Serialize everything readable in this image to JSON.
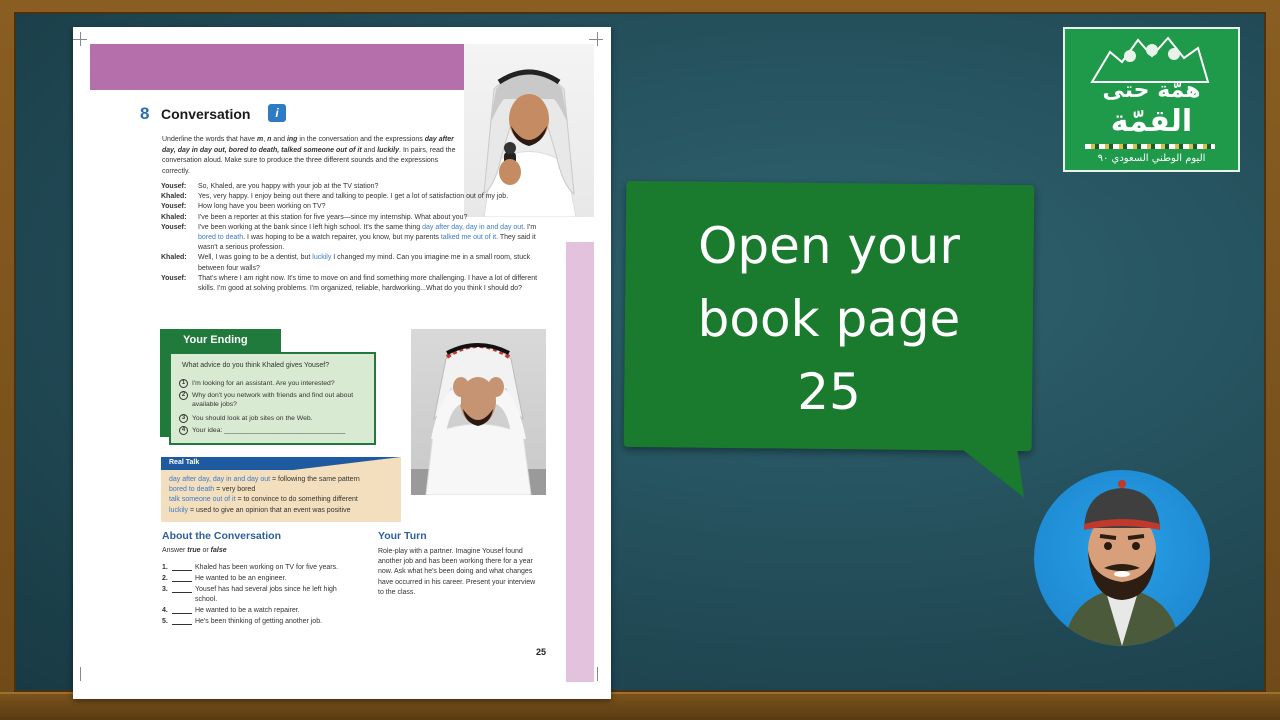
{
  "book": {
    "section_number": "8",
    "section_title": "Conversation",
    "info_icon": "info-icon",
    "intro": {
      "line1": "Underline the words that have ",
      "m": "m",
      "sep1": ", ",
      "n": "n",
      "and1": " and ",
      "ing": "ing",
      "line1b": " in the conversation and the expressions",
      "kw1": "day after day, day in day out, bored to death, talked someone out of it",
      "and2": " and ",
      "kw2": "luckily",
      "dot": ".",
      "line3": "In pairs, read the conversation aloud. Make sure to produce the three different sounds and the expressions correctly."
    },
    "dialogue": [
      {
        "speaker": "Yousef:",
        "text": "So, Khaled, are you happy with your job at the TV station?"
      },
      {
        "speaker": "Khaled:",
        "text": "Yes, very happy. I enjoy being out there and talking to people. I get a lot of satisfaction out of my job."
      },
      {
        "speaker": "Yousef:",
        "text": "How long have you been working on TV?"
      },
      {
        "speaker": "Khaled:",
        "text": "I've been a reporter at this station for five years—since my internship. What about you?"
      },
      {
        "speaker": "Yousef:",
        "text_a": "I've been working at the bank since I left high school. It's the same thing ",
        "hl1": "day after day, day in and day out",
        "text_b": ". I'm ",
        "hl2": "bored to death",
        "text_c": ". I was hoping to be a watch repairer, you know, but my parents ",
        "hl3": "talked me out of it",
        "text_d": ". They said it wasn't a serious profession."
      },
      {
        "speaker": "Khaled:",
        "text_a": "Well, I was going to be a dentist, but ",
        "hl1": "luckily",
        "text_b": " I changed my mind. Can you imagine me in a small room, stuck between four walls?"
      },
      {
        "speaker": "Yousef:",
        "text": "That's where I am right now. It's time to move on and find something more challenging. I have a lot of different skills. I'm good at solving problems. I'm organized, reliable, hardworking...What do you think I should do?"
      }
    ],
    "your_ending": {
      "title": "Your Ending",
      "question": "What advice do you think Khaled gives Yousef?",
      "options": [
        {
          "n": "1",
          "text": "I'm looking for an assistant. Are you interested?"
        },
        {
          "n": "2",
          "text": "Why don't you network with friends and find out about available jobs?"
        },
        {
          "n": "3",
          "text": "You should look at job sites on the Web."
        },
        {
          "n": "4",
          "text": "Your idea: ________________________________"
        }
      ]
    },
    "real_talk": {
      "title": "Real Talk",
      "items": [
        {
          "term": "day after day, day in and day out",
          "def": " = following the same pattern"
        },
        {
          "term": "bored to death",
          "def": " = very bored"
        },
        {
          "term": "talk someone out of it",
          "def": " = to convince to do something different"
        },
        {
          "term": "luckily",
          "def": " = used to give an opinion that an event was positive"
        }
      ]
    },
    "about": {
      "title": "About the Conversation",
      "sub_a": "Answer ",
      "true": "true",
      "or": " or ",
      "false": "false",
      "questions": [
        {
          "n": "1.",
          "text": "Khaled has been working on TV for five years."
        },
        {
          "n": "2.",
          "text": "He wanted to be an engineer."
        },
        {
          "n": "3.",
          "text": "Yousef has had several jobs since he left high school."
        },
        {
          "n": "4.",
          "text": "He wanted to be a watch repairer."
        },
        {
          "n": "5.",
          "text": "He's been thinking of getting another job."
        }
      ]
    },
    "your_turn": {
      "title": "Your Turn",
      "text": "Role-play with a partner. Imagine Yousef found another job and has been working there for a year now. Ask what he's been doing and what changes have occurred in his career. Present your interview to the class."
    },
    "page_number": "25"
  },
  "bubble": {
    "line1": "Open your",
    "line2": "book page",
    "line3": "25"
  },
  "logo": {
    "line1": "همّة حتى",
    "line2": "القمّة",
    "line3": "اليوم الوطني السعودي ٩٠"
  },
  "colors": {
    "board": "#224c58",
    "bubble": "#1a7a2e",
    "logo": "#1f9a4a",
    "accent_purple": "#b56fab",
    "book_blue": "#2b5f9e"
  }
}
